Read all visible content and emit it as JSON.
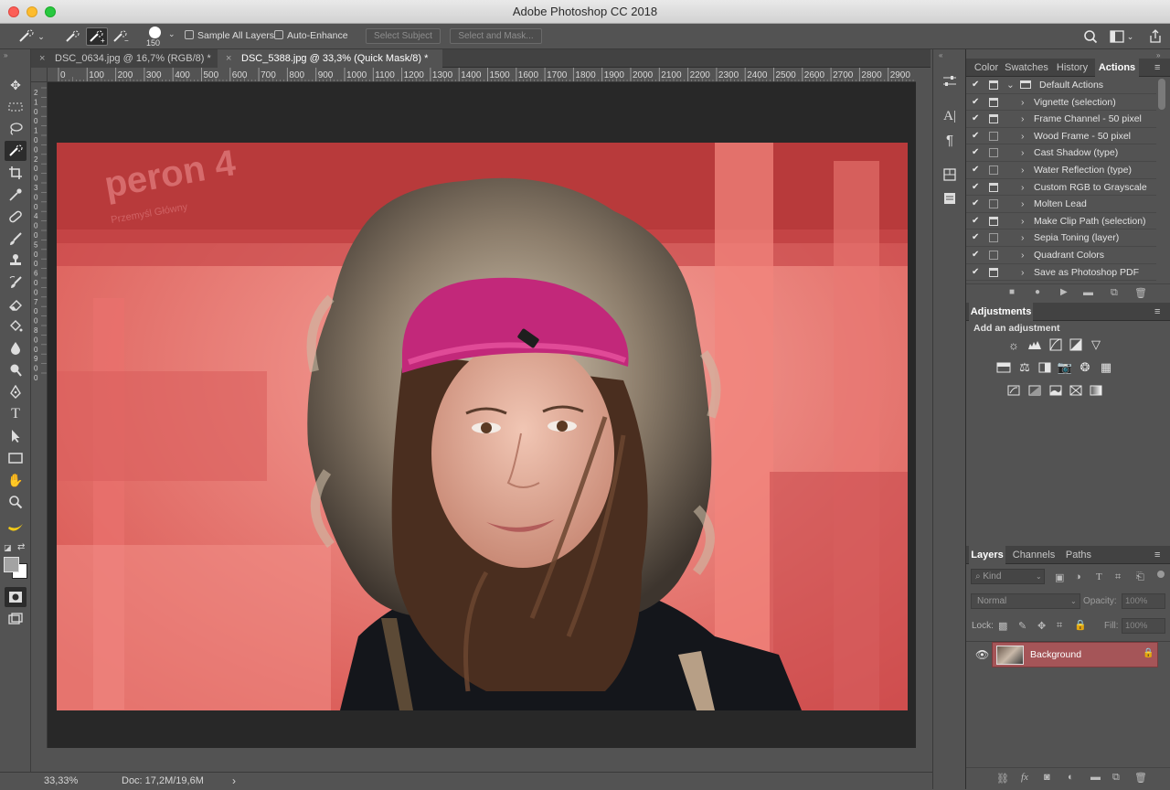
{
  "window": {
    "title": "Adobe Photoshop CC 2018"
  },
  "options_bar": {
    "brush_size": "150",
    "sample_all_layers": "Sample All Layers",
    "auto_enhance": "Auto-Enhance",
    "select_subject": "Select Subject",
    "select_and_mask": "Select and Mask..."
  },
  "tabs": [
    {
      "label": "DSC_0634.jpg @ 16,7% (RGB/8) *",
      "active": false
    },
    {
      "label": "DSC_5388.jpg @ 33,3% (Quick Mask/8) *",
      "active": true
    }
  ],
  "ruler": {
    "top_ticks": [
      "0",
      "100",
      "200",
      "300",
      "400",
      "500",
      "600",
      "700",
      "800",
      "900",
      "1000",
      "1100",
      "1200",
      "1300",
      "1400",
      "1500",
      "1600",
      "1700",
      "1800",
      "1900",
      "2000",
      "2100",
      "2200",
      "2300",
      "2400",
      "2500",
      "2600",
      "2700",
      "2800",
      "2900",
      "3"
    ],
    "left_ticks": [
      "2",
      "1",
      "0",
      "0",
      "1",
      "0",
      "0",
      "2",
      "0",
      "0",
      "3",
      "0",
      "0",
      "4",
      "0",
      "0",
      "5",
      "0",
      "0",
      "6",
      "0",
      "0",
      "7",
      "0",
      "0",
      "8",
      "0",
      "0",
      "9",
      "0",
      "0"
    ]
  },
  "photo": {
    "sign_text": "peron",
    "sign_number": "4",
    "sign_subtext": "Przemyśl Główny",
    "mask_color": "#f0666a"
  },
  "status": {
    "zoom": "33,33%",
    "doc": "Doc: 17,2M/19,6M",
    "arrow": "›"
  },
  "panels": {
    "top_tabs": [
      "Color",
      "Swatches",
      "History",
      "Actions"
    ],
    "actions": [
      {
        "name": "Default Actions",
        "checked": true,
        "dialog": true,
        "folder": true,
        "expanded": true
      },
      {
        "name": "Vignette (selection)",
        "checked": true,
        "dialog": true
      },
      {
        "name": "Frame Channel - 50 pixel",
        "checked": true,
        "dialog": true
      },
      {
        "name": "Wood Frame - 50 pixel",
        "checked": true,
        "dialog": false
      },
      {
        "name": "Cast Shadow (type)",
        "checked": true,
        "dialog": false
      },
      {
        "name": "Water Reflection (type)",
        "checked": true,
        "dialog": false
      },
      {
        "name": "Custom RGB to Grayscale",
        "checked": true,
        "dialog": true
      },
      {
        "name": "Molten Lead",
        "checked": true,
        "dialog": false
      },
      {
        "name": "Make Clip Path (selection)",
        "checked": true,
        "dialog": true
      },
      {
        "name": "Sepia Toning (layer)",
        "checked": true,
        "dialog": false
      },
      {
        "name": "Quadrant Colors",
        "checked": true,
        "dialog": false
      },
      {
        "name": "Save as Photoshop PDF",
        "checked": true,
        "dialog": true
      }
    ],
    "adjustments": {
      "title": "Adjustments",
      "subtitle": "Add an adjustment"
    },
    "layers_tabs": [
      "Layers",
      "Channels",
      "Paths"
    ],
    "layers": {
      "kind": "Kind",
      "blend": "Normal",
      "opacity_label": "Opacity:",
      "opacity_value": "100%",
      "lock_label": "Lock:",
      "fill_label": "Fill:",
      "fill_value": "100%",
      "items": [
        {
          "name": "Background",
          "visible": true,
          "locked": true
        }
      ]
    }
  }
}
